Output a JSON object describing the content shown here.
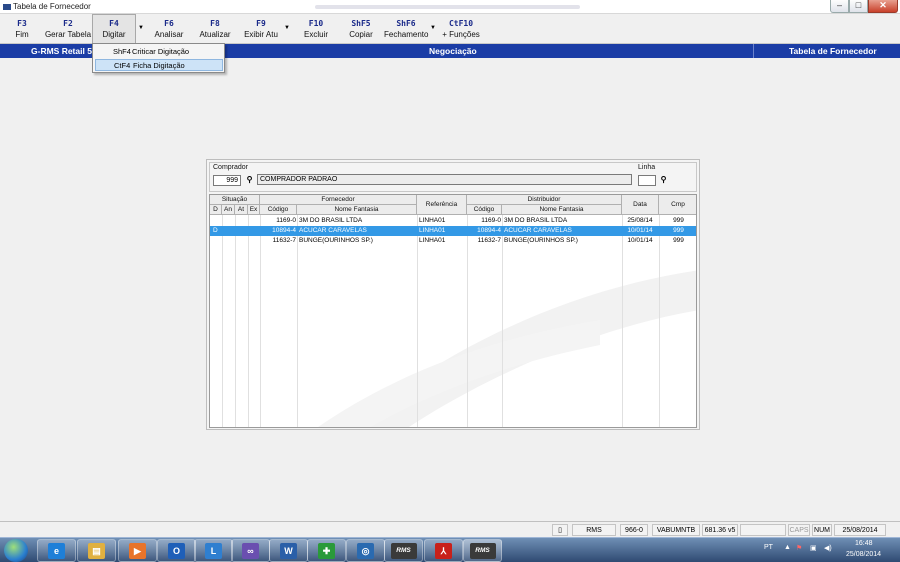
{
  "window": {
    "title": "Tabela de Fornecedor",
    "min": "–",
    "max": "□",
    "close": "✕"
  },
  "toolbar": {
    "buttons": [
      {
        "key": "F3",
        "label": "Fim"
      },
      {
        "key": "F2",
        "label": "Gerar Tabela"
      },
      {
        "key": "F4",
        "label": "Digitar"
      },
      {
        "key": "F6",
        "label": "Analisar"
      },
      {
        "key": "F8",
        "label": "Atualizar"
      },
      {
        "key": "F9",
        "label": "Exibir Atu"
      },
      {
        "key": "F10",
        "label": "Excluir"
      },
      {
        "key": "ShF5",
        "label": "Copiar"
      },
      {
        "key": "ShF6",
        "label": "Fechamento"
      },
      {
        "key": "CtF10",
        "label": "+ Funções"
      }
    ],
    "dropdown_arrow": "▼"
  },
  "header": {
    "left": "G-RMS Retail 5",
    "center": "Negociação",
    "right": "Tabela de Fornecedor"
  },
  "menu": {
    "items": [
      {
        "key": "ShF4",
        "label": "Criticar Digitação"
      },
      {
        "key": "CtF4",
        "label": "Ficha Digitação"
      }
    ]
  },
  "form": {
    "comprador_label": "Comprador",
    "comprador_code": "999",
    "comprador_name": "COMPRADOR PADRAO",
    "linha_label": "Linha",
    "linha_value": "",
    "search_glyph": "⚲"
  },
  "grid": {
    "groups": {
      "situacao": "Situação",
      "fornecedor": "Fornecedor",
      "referencia": "Referência",
      "distribuidor": "Distribuidor",
      "data": "Data",
      "cmp": "Cmp"
    },
    "subheaders": {
      "d": "D",
      "an": "An",
      "at": "At",
      "ex": "Ex",
      "forn_codigo": "Código",
      "forn_nome": "Nome Fantasia",
      "dist_codigo": "Código",
      "dist_nome": "Nome Fantasia"
    },
    "rows": [
      {
        "d": "",
        "forn_codigo": "1169-0",
        "forn_nome": "3M DO BRASIL LTDA",
        "referencia": "LINHA01",
        "dist_codigo": "1169-0",
        "dist_nome": "3M DO BRASIL LTDA",
        "data": "25/08/14",
        "cmp": "999"
      },
      {
        "d": "D",
        "forn_codigo": "10894-4",
        "forn_nome": "ACUCAR CARAVELAS",
        "referencia": "LINHA01",
        "dist_codigo": "10894-4",
        "dist_nome": "ACUCAR CARAVELAS",
        "data": "10/01/14",
        "cmp": "999"
      },
      {
        "d": "",
        "forn_codigo": "11632-7",
        "forn_nome": "BUNGE(OURINHOS SP.)",
        "referencia": "LINHA01",
        "dist_codigo": "11632-7",
        "dist_nome": "BUNGE(OURINHOS SP.)",
        "data": "10/01/14",
        "cmp": "999"
      }
    ]
  },
  "statusbar": {
    "system": "RMS",
    "code": "966-0",
    "user": "VABUMNTB",
    "version": "681.36 v5",
    "caps": "CAPS",
    "num": "NUM",
    "date": "25/08/2014"
  },
  "taskbar": {
    "apps": [
      {
        "name": "ie-icon",
        "glyph": "e",
        "color": "#1e7fd8"
      },
      {
        "name": "explorer-icon",
        "glyph": "▤",
        "color": "#e0b040"
      },
      {
        "name": "media-player-icon",
        "glyph": "▶",
        "color": "#e8742a"
      },
      {
        "name": "outlook-icon",
        "glyph": "O",
        "color": "#1f5fb8"
      },
      {
        "name": "lync-icon",
        "glyph": "L",
        "color": "#2f7fd0"
      },
      {
        "name": "infinity-app-icon",
        "glyph": "∞",
        "color": "#6a4fb0"
      },
      {
        "name": "word-icon",
        "glyph": "W",
        "color": "#2a5fa8"
      },
      {
        "name": "medical-app-icon",
        "glyph": "✚",
        "color": "#2a9a3a"
      },
      {
        "name": "remote-desktop-icon",
        "glyph": "◎",
        "color": "#2a6ab0"
      },
      {
        "name": "rms-icon",
        "glyph": "RMS",
        "color": "#3a3a3a"
      },
      {
        "name": "pdf-icon",
        "glyph": "⅄",
        "color": "#c8201a"
      },
      {
        "name": "rms-active-icon",
        "glyph": "RMS",
        "color": "#3a3a3a"
      }
    ],
    "lang": "PT",
    "time": "16:48",
    "date": "25/08/2014"
  }
}
